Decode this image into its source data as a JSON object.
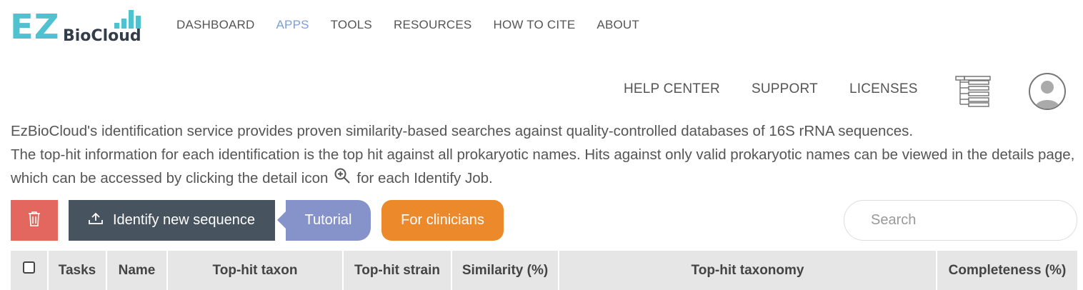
{
  "logo": {
    "ez": "EZ",
    "biocloud": "BioCloud"
  },
  "nav": {
    "items": [
      {
        "label": "DASHBOARD",
        "active": false
      },
      {
        "label": "APPS",
        "active": true
      },
      {
        "label": "TOOLS",
        "active": false
      },
      {
        "label": "RESOURCES",
        "active": false
      },
      {
        "label": "HOW TO CITE",
        "active": false
      },
      {
        "label": "ABOUT",
        "active": false
      }
    ],
    "secondary": {
      "help_center": "HELP CENTER",
      "support": "SUPPORT",
      "licenses": "LICENSES"
    }
  },
  "intro": {
    "line1": "EzBioCloud's identification service provides proven similarity-based searches against quality-controlled databases of 16S rRNA sequences.",
    "line2_before_icon": "The top-hit information for each identification is the top hit against all prokaryotic names. Hits against only valid prokaryotic names can be viewed in the details page, which can be accessed by clicking the detail icon",
    "line2_after_icon": "for each Identify Job."
  },
  "toolbar": {
    "identify_label": "Identify new sequence",
    "tutorial_label": "Tutorial",
    "clinicians_label": "For clinicians",
    "search_placeholder": "Search"
  },
  "table": {
    "headers": [
      "Tasks",
      "Name",
      "Top-hit taxon",
      "Top-hit strain",
      "Similarity (%)",
      "Top-hit taxonomy",
      "Completeness (%)"
    ]
  },
  "colors": {
    "logo_accent": "#4fc1cf",
    "nav_active": "#7aa0d8",
    "delete": "#e3675f",
    "identify": "#47535f",
    "tutorial": "#8693cb",
    "clinicians": "#ec8a2b",
    "table_header_bg": "#e6e6e6"
  },
  "icons": {
    "delete": "trash-icon",
    "identify": "upload-icon",
    "detail": "zoom-in-icon",
    "menu": "tree-list-icon",
    "user": "user-avatar-icon"
  }
}
